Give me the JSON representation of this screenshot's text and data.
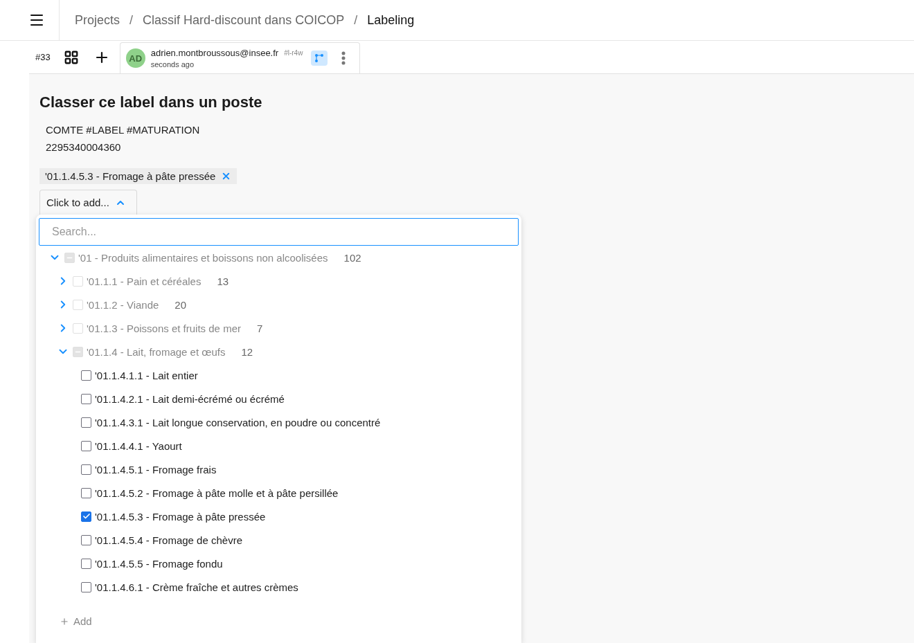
{
  "header": {
    "separator": "/",
    "breadcrumbs": [
      {
        "label": "Projects",
        "current": false
      },
      {
        "label": "Classif Hard-discount dans COICOP",
        "current": false
      },
      {
        "label": "Labeling",
        "current": true
      }
    ]
  },
  "toolbar": {
    "task_id": "#33",
    "annotation": {
      "avatar": "AD",
      "user": "adrien.montbroussous@insee.fr",
      "id": "#l-r4w",
      "time": "seconds ago"
    }
  },
  "form": {
    "title": "Classer ce label dans un poste",
    "text_lines": [
      "COMTE #LABEL #MATURATION",
      "2295340004360"
    ],
    "chips": [
      {
        "label": "'01.1.4.5.3 - Fromage à pâte pressée"
      }
    ],
    "picker": {
      "label": "Click to add...",
      "expanded": true
    },
    "search": {
      "placeholder": "Search..."
    },
    "tree": [
      {
        "kind": "group",
        "label": "'01 - Produits alimentaires et boissons non alcoolisées",
        "count": "102",
        "expanded": true,
        "checked": false,
        "partial": true,
        "children": [
          {
            "kind": "group",
            "label": "'01.1.1 - Pain et céréales",
            "count": "13",
            "expanded": false,
            "checked": false,
            "partial": false
          },
          {
            "kind": "group",
            "label": "'01.1.2 - Viande",
            "count": "20",
            "expanded": false,
            "checked": false,
            "partial": false
          },
          {
            "kind": "group",
            "label": "'01.1.3 - Poissons et fruits de mer",
            "count": "7",
            "expanded": false,
            "checked": false,
            "partial": false
          },
          {
            "kind": "group",
            "label": "'01.1.4 - Lait, fromage et œufs",
            "count": "12",
            "expanded": true,
            "checked": false,
            "partial": true,
            "children": [
              {
                "kind": "leaf",
                "label": "'01.1.4.1.1 - Lait entier",
                "checked": false
              },
              {
                "kind": "leaf",
                "label": "'01.1.4.2.1 - Lait demi-écrémé ou écrémé",
                "checked": false
              },
              {
                "kind": "leaf",
                "label": "'01.1.4.3.1 - Lait longue conservation, en poudre ou concentré",
                "checked": false
              },
              {
                "kind": "leaf",
                "label": "'01.1.4.4.1 - Yaourt",
                "checked": false
              },
              {
                "kind": "leaf",
                "label": "'01.1.4.5.1 - Fromage frais",
                "checked": false
              },
              {
                "kind": "leaf",
                "label": "'01.1.4.5.2 - Fromage à pâte molle et à pâte persillée",
                "checked": false
              },
              {
                "kind": "leaf",
                "label": "'01.1.4.5.3 - Fromage à pâte pressée",
                "checked": true
              },
              {
                "kind": "leaf",
                "label": "'01.1.4.5.4 - Fromage de chèvre",
                "checked": false
              },
              {
                "kind": "leaf",
                "label": "'01.1.4.5.5 - Fromage fondu",
                "checked": false
              },
              {
                "kind": "leaf",
                "label": "'01.1.4.6.1 - Crème fraîche et autres crèmes",
                "checked": false
              }
            ]
          }
        ]
      }
    ],
    "add_label": "Add"
  }
}
